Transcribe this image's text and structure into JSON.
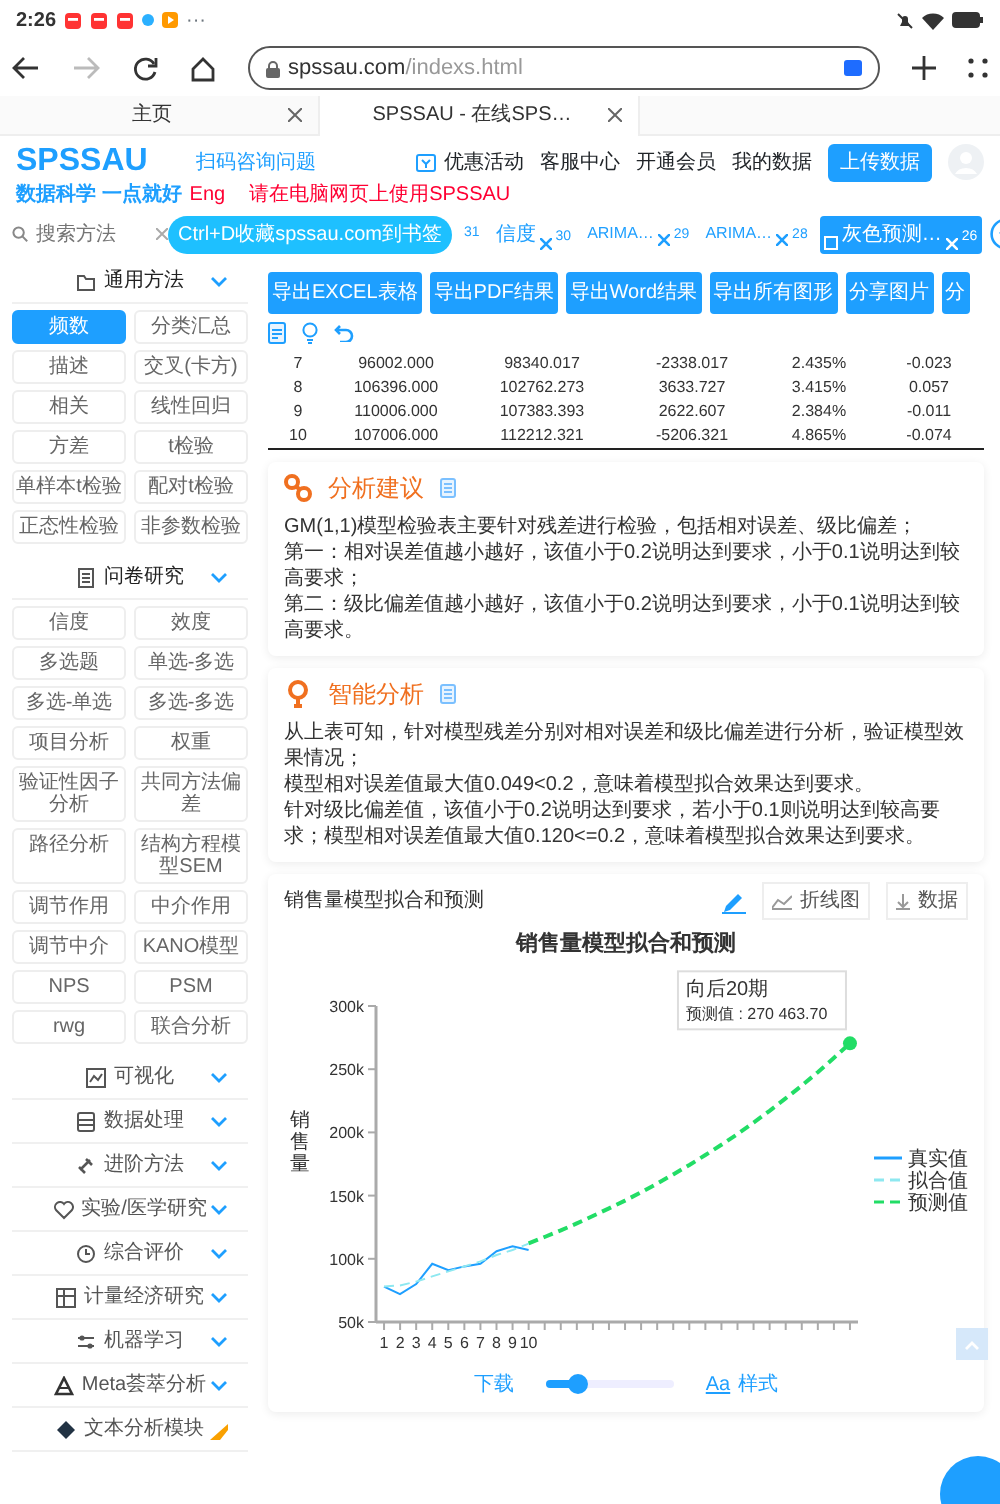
{
  "status_bar": {
    "time": "2:26",
    "more": "···"
  },
  "browser": {
    "url_host": "spssau.com",
    "url_path": "/indexs.html",
    "tabs": [
      {
        "title": "主页",
        "selected": false
      },
      {
        "title": "SPSSAU - 在线SPS…",
        "selected": true
      }
    ]
  },
  "header": {
    "logo": "SPSSAU",
    "slogan": "数据科学 一点就好",
    "lang": "Eng",
    "qr_link": "扫码咨询问题",
    "notice": "请在电脑网页上使用SPSSAU",
    "nav": [
      "优惠活动",
      "客服中心",
      "开通会员",
      "我的数据"
    ],
    "upload": "上传数据"
  },
  "toolbar": {
    "search": {
      "placeholder": "搜索方法"
    },
    "bookmark_tip": "Ctrl+D收藏spssau.com到书签",
    "history": [
      {
        "count": "31",
        "selected": false
      },
      {
        "label": "信度",
        "count": "30",
        "selected": false
      },
      {
        "label": "ARIMA…",
        "count": "29",
        "selected": false
      },
      {
        "label": "ARIMA…",
        "count": "28",
        "selected": false
      },
      {
        "label": "灰色预测…",
        "count": "26",
        "selected": true
      }
    ]
  },
  "sidebar": {
    "sections": [
      {
        "title": "通用方法",
        "expanded": true,
        "new": false,
        "items": [
          {
            "label": "频数",
            "selected": true
          },
          {
            "label": "分类汇总",
            "selected": false
          },
          {
            "label": "描述",
            "selected": false
          },
          {
            "label": "交叉(卡方)",
            "selected": false
          },
          {
            "label": "相关",
            "selected": false
          },
          {
            "label": "线性回归",
            "selected": false
          },
          {
            "label": "方差",
            "selected": false
          },
          {
            "label": "t检验",
            "selected": false
          },
          {
            "label": "单样本t检验",
            "selected": false
          },
          {
            "label": "配对t检验",
            "selected": false
          },
          {
            "label": "正态性检验",
            "selected": false
          },
          {
            "label": "非参数检验",
            "selected": false
          }
        ]
      },
      {
        "title": "问卷研究",
        "expanded": true,
        "new": false,
        "items": [
          {
            "label": "信度",
            "selected": false
          },
          {
            "label": "效度",
            "selected": false
          },
          {
            "label": "多选题",
            "selected": false
          },
          {
            "label": "单选-多选",
            "selected": false
          },
          {
            "label": "多选-单选",
            "selected": false
          },
          {
            "label": "多选-多选",
            "selected": false
          },
          {
            "label": "项目分析",
            "selected": false
          },
          {
            "label": "权重",
            "selected": false
          },
          {
            "label": "验证性因子分析",
            "selected": false
          },
          {
            "label": "共同方法偏差",
            "selected": false
          },
          {
            "label": "路径分析",
            "selected": false
          },
          {
            "label": "结构方程模型SEM",
            "selected": false
          },
          {
            "label": "调节作用",
            "selected": false
          },
          {
            "label": "中介作用",
            "selected": false
          },
          {
            "label": "调节中介",
            "selected": false
          },
          {
            "label": "KANO模型",
            "selected": false
          },
          {
            "label": "NPS",
            "selected": false
          },
          {
            "label": "PSM",
            "selected": false
          },
          {
            "label": "rwg",
            "selected": false
          },
          {
            "label": "联合分析",
            "selected": false
          }
        ]
      },
      {
        "title": "可视化",
        "expanded": false,
        "new": false
      },
      {
        "title": "数据处理",
        "expanded": false,
        "new": false
      },
      {
        "title": "进阶方法",
        "expanded": false,
        "new": false
      },
      {
        "title": "实验/医学研究",
        "expanded": false,
        "new": false
      },
      {
        "title": "综合评价",
        "expanded": false,
        "new": false
      },
      {
        "title": "计量经济研究",
        "expanded": false,
        "new": false
      },
      {
        "title": "机器学习",
        "expanded": false,
        "new": false
      },
      {
        "title": "Meta荟萃分析",
        "expanded": false,
        "new": false
      },
      {
        "title": "文本分析模块",
        "expanded": false,
        "new": true
      }
    ]
  },
  "main": {
    "export_buttons": [
      "导出EXCEL表格",
      "导出PDF结果",
      "导出Word结果",
      "导出所有图形",
      "分享图片",
      "分"
    ],
    "results_table": {
      "rows": [
        [
          "7",
          "96002.000",
          "98340.017",
          "-2338.017",
          "2.435%",
          "-0.023"
        ],
        [
          "8",
          "106396.000",
          "102762.273",
          "3633.727",
          "3.415%",
          "0.057"
        ],
        [
          "9",
          "110006.000",
          "107383.393",
          "2622.607",
          "2.384%",
          "-0.011"
        ],
        [
          "10",
          "107006.000",
          "112212.321",
          "-5206.321",
          "4.865%",
          "-0.074"
        ]
      ]
    },
    "advice": {
      "title": "分析建议",
      "paragraphs": [
        "GM(1,1)模型检验表主要针对残差进行检验，包括相对误差、级比偏差；",
        "第一：相对误差值越小越好，该值小于0.2说明达到要求，小于0.1说明达到较高要求；",
        "第二：级比偏差值越小越好，该值小于0.2说明达到要求，小于0.1说明达到较高要求。"
      ]
    },
    "smart": {
      "title": "智能分析",
      "paragraphs": [
        "从上表可知，针对模型残差分别对相对误差和级比偏差进行分析，验证模型效果情况；",
        "模型相对误差值最大值0.049<0.2，意味着模型拟合效果达到要求。",
        "针对级比偏差值，该值小于0.2说明达到要求，若小于0.1则说明达到较高要求；模型相对误差值最大值0.120<=0.2，意味着模型拟合效果达到要求。"
      ]
    },
    "chart_panel": {
      "title": "销售量模型拟合和预测",
      "buttons": [
        "折线图",
        "数据"
      ],
      "chart_data": {
        "type": "line",
        "title": "销售量模型拟合和预测",
        "ylabel": "销售量",
        "x": [
          1,
          2,
          3,
          4,
          5,
          6,
          7,
          8,
          9,
          10,
          11,
          12,
          13,
          14,
          15,
          16,
          17,
          18,
          19,
          20,
          21,
          22,
          23,
          24,
          25,
          26,
          27,
          28,
          29,
          30
        ],
        "xlim": [
          0.5,
          30.5
        ],
        "legend": "right",
        "xticks": [
          1,
          2,
          3,
          4,
          5,
          6,
          7,
          8,
          9,
          10
        ],
        "yticks": [
          {
            "value": 50000,
            "label": "50k"
          },
          {
            "value": 100000,
            "label": "100k"
          },
          {
            "value": 150000,
            "label": "150k"
          },
          {
            "value": 200000,
            "label": "200k"
          },
          {
            "value": 250000,
            "label": "250k"
          },
          {
            "value": 300000,
            "label": "300k"
          }
        ],
        "ylim": [
          50000,
          300000
        ],
        "series": [
          {
            "name": "真实值",
            "color": "#1e9fff",
            "line_style": "solid",
            "values": [
              78000,
              72000,
              80000,
              96000,
              91000,
              94000,
              96000,
              106000,
              110000,
              107000,
              null,
              null,
              null,
              null,
              null,
              null,
              null,
              null,
              null,
              null,
              null,
              null,
              null,
              null,
              null,
              null,
              null,
              null,
              null,
              null
            ]
          },
          {
            "name": "拟合值",
            "color": "#8ee8f0",
            "line_style": "dashed",
            "values": [
              78000,
              79000,
              82000,
              86000,
              90000,
              94000,
              98000,
              103000,
              107000,
              112000,
              null,
              null,
              null,
              null,
              null,
              null,
              null,
              null,
              null,
              null,
              null,
              null,
              null,
              null,
              null,
              null,
              null,
              null,
              null,
              null
            ]
          },
          {
            "name": "预测值",
            "color": "#22dd66",
            "line_style": "dashed",
            "values": [
              null,
              null,
              null,
              null,
              null,
              null,
              null,
              null,
              null,
              112212,
              117259,
              122531,
              128041,
              133799,
              139816,
              146103,
              152673,
              159539,
              166713,
              174210,
              182044,
              190230,
              198785,
              207724,
              217065,
              226826,
              237026,
              247685,
              258823,
              270464
            ]
          }
        ]
      },
      "tooltip": {
        "title": "向后20期",
        "text": "预测值 : 270 463.70"
      },
      "download": "下载",
      "size_slider": {
        "level": 0.25
      },
      "style_glyph": "Aa",
      "style": "样式"
    }
  }
}
